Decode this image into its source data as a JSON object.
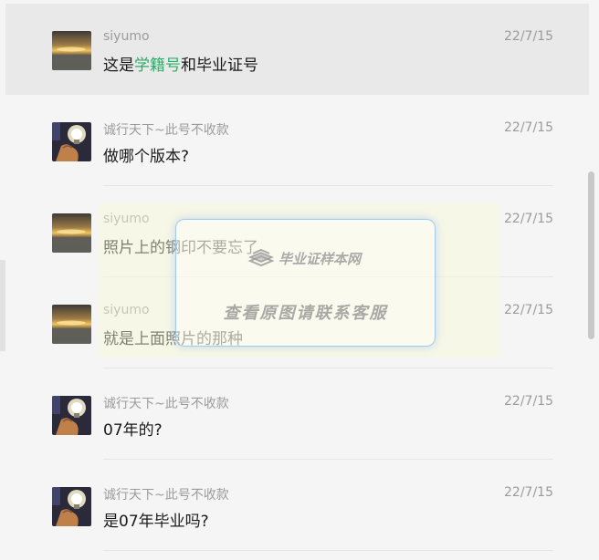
{
  "chats": [
    {
      "name": "siyumo",
      "time": "22/7/15",
      "message_parts": [
        "这是",
        "学籍号",
        "和毕业证号"
      ],
      "avatar": "sunset-avatar",
      "selected": true
    },
    {
      "name": "诚行天下~此号不收款",
      "time": "22/7/15",
      "message": "做哪个版本?",
      "avatar": "hand-lightbulb-avatar"
    },
    {
      "name": "siyumo",
      "time": "22/7/15",
      "message": "照片上的钢印不要忘了",
      "avatar": "sunset-avatar"
    },
    {
      "name": "siyumo",
      "time": "22/7/15",
      "message": "就是上面照片的那种",
      "avatar": "sunset-avatar"
    },
    {
      "name": "诚行天下~此号不收款",
      "time": "22/7/15",
      "message": "07年的?",
      "avatar": "hand-lightbulb-avatar"
    },
    {
      "name": "诚行天下~此号不收款",
      "time": "22/7/15",
      "message": "是07年毕业吗?",
      "avatar": "hand-lightbulb-avatar"
    }
  ],
  "watermark": {
    "logo_text": "毕业证样本网",
    "contact_text": "查看原图请联系客服"
  },
  "colors": {
    "highlight": "#2aae67",
    "selected_bg": "#e9e9e9",
    "meta_text": "#9b9b9b"
  }
}
